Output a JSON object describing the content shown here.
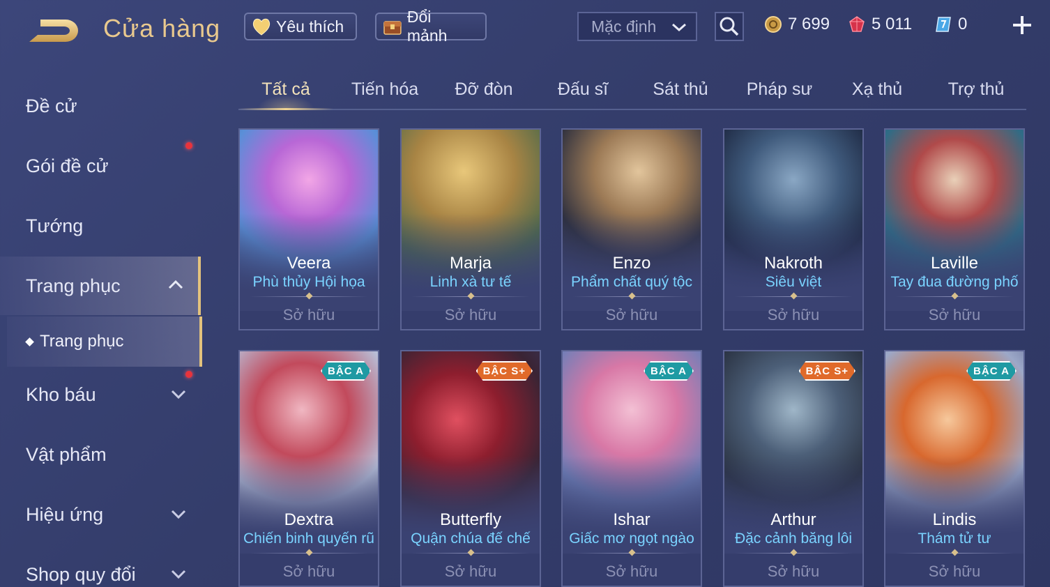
{
  "header": {
    "title": "Cửa hàng",
    "favorite_label": "Yêu thích",
    "exchange_label": "Đổi mảnh",
    "sort_label": "Mặc định",
    "currencies": [
      {
        "name": "vang",
        "value": "7 699"
      },
      {
        "name": "quan-huy",
        "value": "5 011"
      },
      {
        "name": "ve",
        "value": "0"
      }
    ]
  },
  "sidebar": {
    "items": [
      {
        "label": "Đề cử"
      },
      {
        "label": "Gói đề cử"
      },
      {
        "label": "Tướng"
      },
      {
        "label": "Trang phục"
      },
      {
        "label": "Kho báu"
      },
      {
        "label": "Vật phẩm"
      },
      {
        "label": "Hiệu ứng"
      },
      {
        "label": "Shop quy đổi"
      }
    ],
    "sub_item": "Trang phục"
  },
  "tabs": [
    "Tất cả",
    "Tiến hóa",
    "Đỡ đòn",
    "Đấu sĩ",
    "Sát thủ",
    "Pháp sư",
    "Xạ thủ",
    "Trợ thủ"
  ],
  "cards": [
    {
      "hero": "Veera",
      "skin": "Phù thủy Hội họa",
      "status": "Sở hữu",
      "badge": ""
    },
    {
      "hero": "Marja",
      "skin": "Linh xà tư tế",
      "status": "Sở hữu",
      "badge": ""
    },
    {
      "hero": "Enzo",
      "skin": "Phẩm chất quý tộc",
      "status": "Sở hữu",
      "badge": ""
    },
    {
      "hero": "Nakroth",
      "skin": "Siêu việt",
      "status": "Sở hữu",
      "badge": ""
    },
    {
      "hero": "Laville",
      "skin": "Tay đua đường phố",
      "status": "Sở hữu",
      "badge": ""
    },
    {
      "hero": "Dextra",
      "skin": "Chiến binh quyến rũ",
      "status": "Sở hữu",
      "badge": "BẬC A"
    },
    {
      "hero": "Butterfly",
      "skin": "Quận chúa đế chế",
      "status": "Sở hữu",
      "badge": "BẬC S+"
    },
    {
      "hero": "Ishar",
      "skin": "Giấc mơ ngọt ngào",
      "status": "Sở hữu",
      "badge": "BẬC A"
    },
    {
      "hero": "Arthur",
      "skin": "Đặc cảnh băng lôi",
      "status": "Sở hữu",
      "badge": "BẬC S+"
    },
    {
      "hero": "Lindis",
      "skin": "Thám tử tư",
      "status": "Sở hữu",
      "badge": "BẬC A"
    }
  ],
  "colors": {
    "accent_gold": "#e9c98e",
    "skin_blue": "#7ad3ff",
    "badge_a": "#1f9aa3",
    "badge_s": "#e06a2a"
  }
}
